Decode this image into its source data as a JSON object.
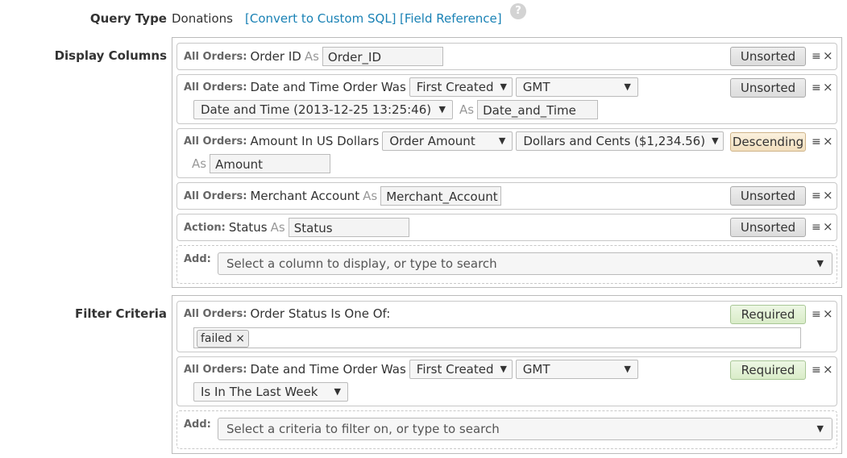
{
  "query_type": {
    "label": "Query Type",
    "value": "Donations",
    "convert_link": "[Convert to Custom SQL]",
    "reference_link": "[Field Reference]",
    "help": "?"
  },
  "display_columns": {
    "label": "Display Columns",
    "rows": [
      {
        "source": "All Orders:",
        "field": "Order ID",
        "as": "As",
        "alias": "Order_ID",
        "sort": "Unsorted"
      },
      {
        "source": "All Orders:",
        "field": "Date and Time Order Was",
        "select1": "First Created",
        "select2": "GMT",
        "select3": "Date and Time (2013-12-25 13:25:46)",
        "as": "As",
        "alias": "Date_and_Time",
        "sort": "Unsorted"
      },
      {
        "source": "All Orders:",
        "field": "Amount In US Dollars",
        "select1": "Order Amount",
        "select2": "Dollars and Cents ($1,234.56)",
        "as": "As",
        "alias": "Amount",
        "sort": "Descending"
      },
      {
        "source": "All Orders:",
        "field": "Merchant Account",
        "as": "As",
        "alias": "Merchant_Account",
        "sort": "Unsorted"
      },
      {
        "source": "Action:",
        "field": "Status",
        "as": "As",
        "alias": "Status",
        "sort": "Unsorted"
      }
    ],
    "add_label": "Add:",
    "add_placeholder": "Select a column to display, or type to search"
  },
  "filter_criteria": {
    "label": "Filter Criteria",
    "rows": [
      {
        "source": "All Orders:",
        "field": "Order Status Is One Of:",
        "tag": "failed",
        "tag_remove": "×",
        "badge": "Required"
      },
      {
        "source": "All Orders:",
        "field": "Date and Time Order Was",
        "select1": "First Created",
        "select2": "GMT",
        "select3": "Is In The Last Week",
        "badge": "Required"
      }
    ],
    "add_label": "Add:",
    "add_placeholder": "Select a criteria to filter on, or type to search"
  },
  "icons": {
    "drag": "≡",
    "remove": "×",
    "caret": "▼"
  },
  "colors": {
    "link": "#1a82b5",
    "descending_bg": "#f5e4c6",
    "required_bg": "#e1f0d3"
  }
}
